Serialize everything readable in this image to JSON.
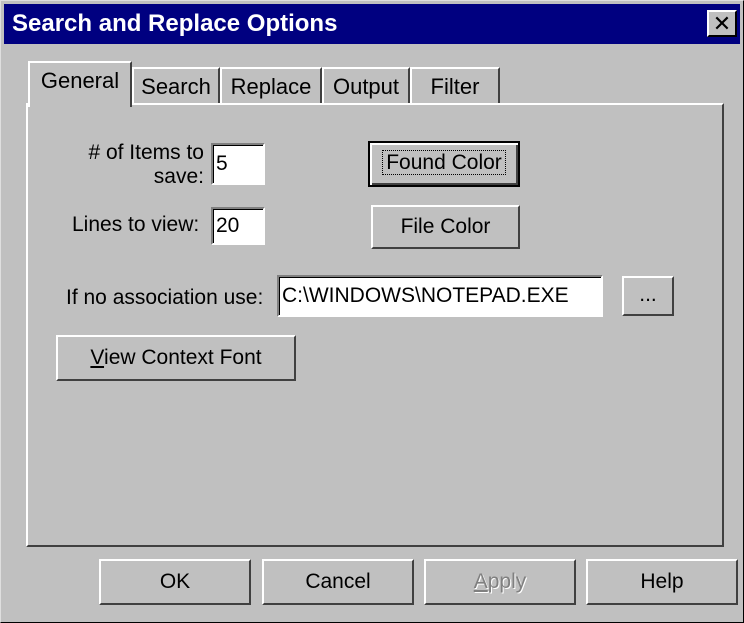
{
  "window": {
    "title": "Search and Replace Options",
    "close_glyph": "✕"
  },
  "tabs": [
    {
      "label": "General",
      "active": true
    },
    {
      "label": "Search",
      "active": false
    },
    {
      "label": "Replace",
      "active": false
    },
    {
      "label": "Output",
      "active": false
    },
    {
      "label": "Filter",
      "active": false
    }
  ],
  "general": {
    "items_label_line1": "# of Items to",
    "items_label_line2": "save:",
    "items_value": "5",
    "lines_label": "Lines to view:",
    "lines_value": "20",
    "found_color_label": "Found Color",
    "file_color_label": "File Color",
    "association_label": "If no association use:",
    "association_value": "C:\\WINDOWS\\NOTEPAD.EXE",
    "browse_label": "...",
    "view_font_first": "V",
    "view_font_rest": "iew Context Font"
  },
  "footer": {
    "ok_label": "OK",
    "cancel_label": "Cancel",
    "apply_first": "A",
    "apply_rest": "pply",
    "help_label": "Help"
  },
  "colors": {
    "titlebar": "#000080",
    "face": "#c0c0c0",
    "disabled_text": "#808080"
  }
}
